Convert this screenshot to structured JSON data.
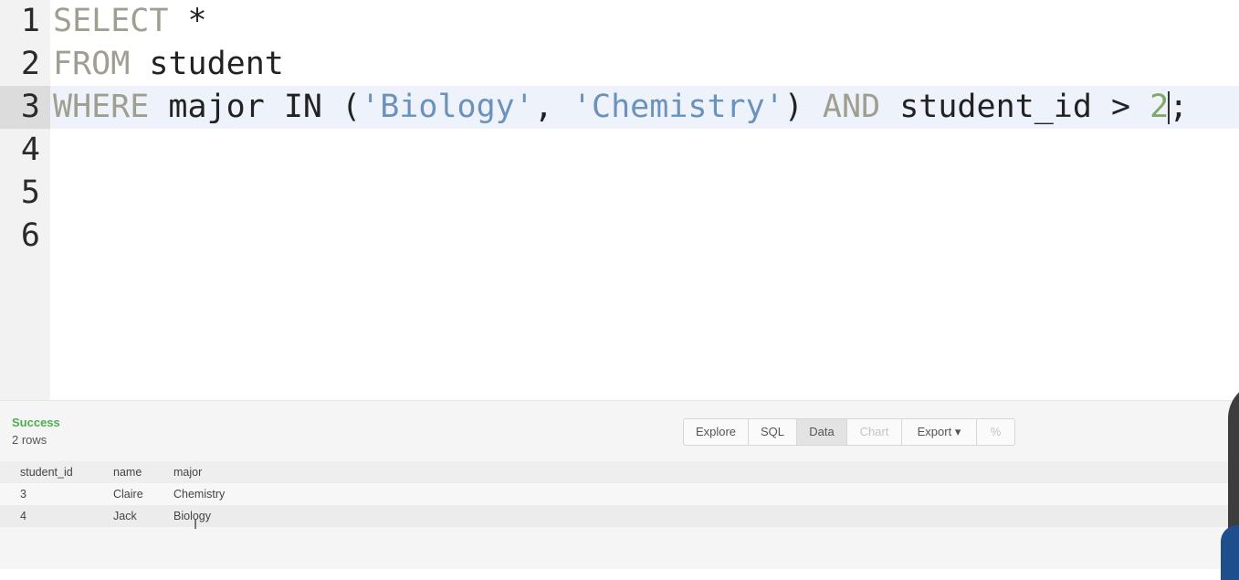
{
  "editor": {
    "line_numbers": [
      "1",
      "2",
      "3",
      "4",
      "5",
      "6"
    ],
    "line1": {
      "kw1": "SELECT",
      "rest": " *"
    },
    "line2": {
      "kw1": "FROM",
      "rest": " student"
    },
    "line3": {
      "kw1": "WHERE",
      "t1": " major IN (",
      "s1": "'Biology'",
      "t2": ", ",
      "s2": "'Chemistry'",
      "t3": ") ",
      "kw2": "AND",
      "t4": " student_id > ",
      "n1": "2",
      "t5": ";"
    }
  },
  "results": {
    "status": "Success",
    "row_count": "2 rows",
    "toolbar": [
      "Explore",
      "SQL",
      "Data",
      "Chart",
      "Export ▾",
      "%"
    ],
    "columns": [
      "student_id",
      "name",
      "major"
    ],
    "rows": [
      [
        "3",
        "Claire",
        "Chemistry"
      ],
      [
        "4",
        "Jack",
        "Biology"
      ]
    ]
  },
  "colors": {
    "keyword": "#a09e90",
    "string": "#6b92bd",
    "number": "#7fa96a",
    "success": "#4caf50"
  }
}
